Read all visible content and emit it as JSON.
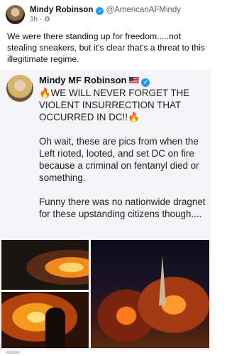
{
  "post": {
    "author_name": "Mindy Robinson",
    "handle": "@AmericanAFMindy",
    "time": "3h",
    "audience_glyph": "·",
    "text": "We were there standing up for freedom.....not stealing sneakers, but it's clear that's a threat to this illegitimate regime."
  },
  "quoted_post": {
    "author_name": "Mindy MF Robinson",
    "text": "🔥WE WILL NEVER FORGET THE VIOLENT INSURRECTION THAT OCCURRED IN DC!!🔥\n\nOh wait, these are pics from when the Left rioted, looted, and set DC on fire because a criminal on fentanyl died or something.\n\nFunny there was no nationwide dragnet for these upstanding citizens though....",
    "images": [
      "riot-fire-street",
      "dc-night-fires",
      "fire-protester"
    ]
  },
  "icons": {
    "verified": "verified-badge-icon",
    "flag": "us-flag-icon",
    "fire": "fire-icon"
  },
  "colors": {
    "accent": "#1d9bf0",
    "text": "#0f1419",
    "muted": "#536471"
  }
}
